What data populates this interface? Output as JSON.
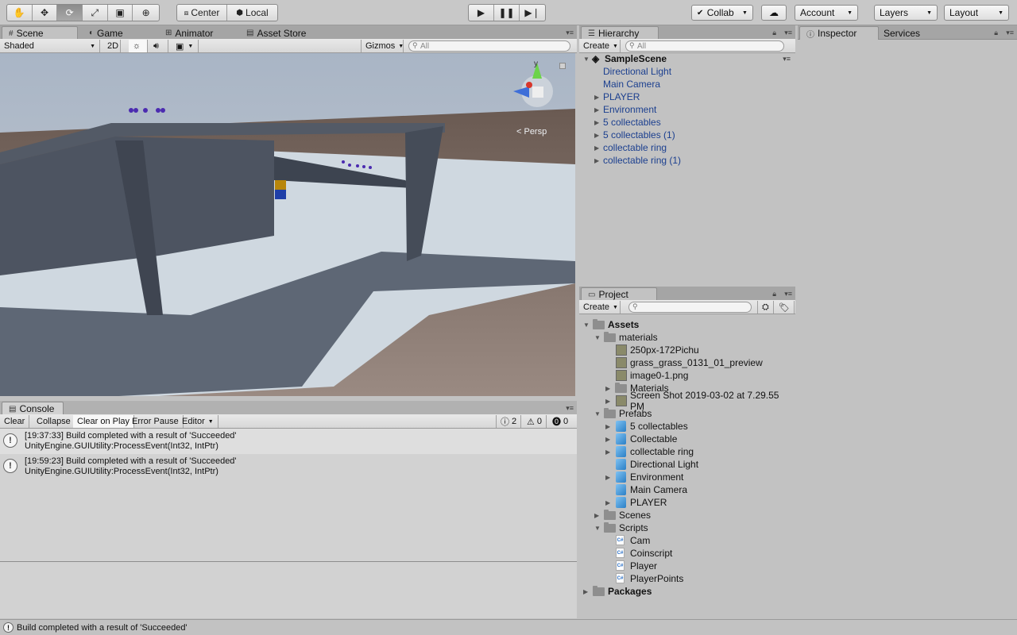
{
  "toolbar": {
    "tools": [
      "hand-icon",
      "move-icon",
      "rotate-icon",
      "scale-icon",
      "rect-icon",
      "transform-icon"
    ],
    "pivot": "Center",
    "space": "Local",
    "collab": "Collab",
    "account": "Account",
    "layers": "Layers",
    "layout": "Layout"
  },
  "scene": {
    "tabs": [
      "Scene",
      "Game",
      "Animator",
      "Asset Store"
    ],
    "shading": "Shaded",
    "mode2d": "2D",
    "gizmos": "Gizmos",
    "search_placeholder": "All",
    "persp": "< Persp",
    "gizmo_axes": {
      "y": "y"
    }
  },
  "hierarchy": {
    "tab": "Hierarchy",
    "create": "Create",
    "search_placeholder": "All",
    "scene": "SampleScene",
    "items": [
      {
        "label": "Directional Light",
        "children": false
      },
      {
        "label": "Main Camera",
        "children": false
      },
      {
        "label": "PLAYER",
        "children": true
      },
      {
        "label": "Environment",
        "children": true
      },
      {
        "label": "5 collectables",
        "children": true
      },
      {
        "label": "5 collectables (1)",
        "children": true
      },
      {
        "label": "collectable ring",
        "children": true
      },
      {
        "label": "collectable ring (1)",
        "children": true
      }
    ]
  },
  "inspector": {
    "tabs": [
      "Inspector",
      "Services"
    ]
  },
  "project": {
    "tab": "Project",
    "create": "Create",
    "tree": [
      {
        "label": "Assets",
        "depth": 0,
        "kind": "folder",
        "open": true,
        "bold": true
      },
      {
        "label": "materials",
        "depth": 1,
        "kind": "folder",
        "open": true
      },
      {
        "label": "250px-172Pichu",
        "depth": 2,
        "kind": "image"
      },
      {
        "label": "grass_grass_0131_01_preview",
        "depth": 2,
        "kind": "image"
      },
      {
        "label": "image0-1.png",
        "depth": 2,
        "kind": "image"
      },
      {
        "label": "Materials",
        "depth": 2,
        "kind": "folder",
        "open": false
      },
      {
        "label": "Screen Shot 2019-03-02 at 7.29.55 PM",
        "depth": 2,
        "kind": "image",
        "collapsed": true
      },
      {
        "label": "Prefabs",
        "depth": 1,
        "kind": "folder",
        "open": true
      },
      {
        "label": "5 collectables",
        "depth": 2,
        "kind": "prefab",
        "collapsed": true
      },
      {
        "label": "Collectable",
        "depth": 2,
        "kind": "prefab",
        "collapsed": true
      },
      {
        "label": "collectable ring",
        "depth": 2,
        "kind": "prefab",
        "collapsed": true
      },
      {
        "label": "Directional Light",
        "depth": 2,
        "kind": "prefab"
      },
      {
        "label": "Environment",
        "depth": 2,
        "kind": "prefab",
        "collapsed": true
      },
      {
        "label": "Main Camera",
        "depth": 2,
        "kind": "prefab"
      },
      {
        "label": "PLAYER",
        "depth": 2,
        "kind": "prefab",
        "collapsed": true
      },
      {
        "label": "Scenes",
        "depth": 1,
        "kind": "folder",
        "open": false
      },
      {
        "label": "Scripts",
        "depth": 1,
        "kind": "folder",
        "open": true
      },
      {
        "label": "Cam",
        "depth": 2,
        "kind": "script"
      },
      {
        "label": "Coinscript",
        "depth": 2,
        "kind": "script"
      },
      {
        "label": "Player",
        "depth": 2,
        "kind": "script"
      },
      {
        "label": "PlayerPoints",
        "depth": 2,
        "kind": "script"
      },
      {
        "label": "Packages",
        "depth": 0,
        "kind": "folder",
        "open": false,
        "bold": true
      }
    ]
  },
  "console": {
    "tab": "Console",
    "buttons": [
      "Clear",
      "Collapse",
      "Clear on Play",
      "Error Pause",
      "Editor"
    ],
    "counts": {
      "info": "2",
      "warn": "0",
      "error": "0"
    },
    "entries": [
      {
        "line1": "[19:37:33] Build completed with a result of 'Succeeded'",
        "line2": "UnityEngine.GUIUtility:ProcessEvent(Int32, IntPtr)"
      },
      {
        "line1": "[19:59:23] Build completed with a result of 'Succeeded'",
        "line2": "UnityEngine.GUIUtility:ProcessEvent(Int32, IntPtr)"
      }
    ]
  },
  "status": {
    "text": "Build completed with a result of 'Succeeded'"
  },
  "colors": {
    "link": "#1b3f8f",
    "panel": "#c2c2c2",
    "tabbar": "#a5a5a5"
  }
}
